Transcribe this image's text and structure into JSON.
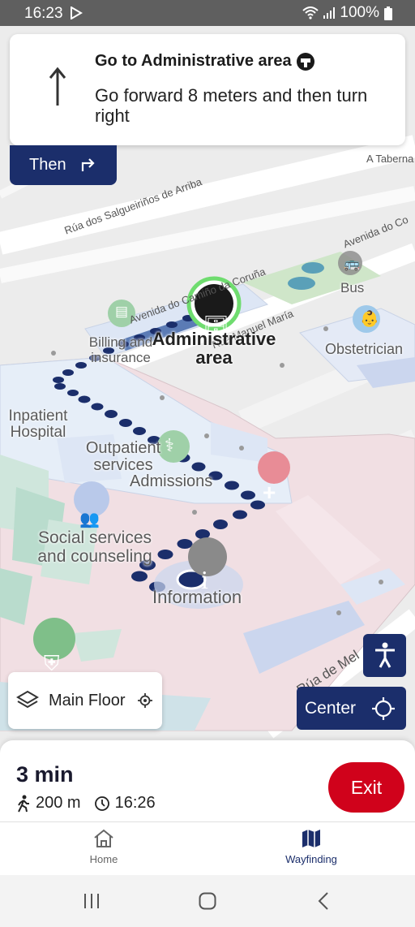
{
  "status": {
    "time": "16:23",
    "battery": "100%"
  },
  "instruction": {
    "destination": "Go to Administrative area",
    "step": "Go forward 8 meters and then turn right",
    "then_label": "Then"
  },
  "map": {
    "streets": [
      "Rúa dos Salgueiriños de Arriba",
      "Avenida do Co",
      "A Taberna c",
      "Avenida do Camiño da Coruña",
      "Rúa Manuel María",
      "Rúa de Mel"
    ],
    "pois": {
      "admin": "Administrative area",
      "billing": "Billing and insurance",
      "bus": "Bus",
      "obstetrician": "Obstetrician",
      "inpatient": "Inpatient Hospital",
      "outpatient": "Outpatient services",
      "admissions": "Admissions",
      "social": "Social services and counseling",
      "information": "Information"
    },
    "colors": {
      "route": "#1b2e6b",
      "accent": "#1b2e6b",
      "exit": "#d0021b"
    }
  },
  "controls": {
    "floor_label": "Main Floor",
    "center_label": "Center"
  },
  "trip": {
    "duration": "3 min",
    "distance": "200 m",
    "arrival": "16:26",
    "exit_label": "Exit"
  },
  "nav": {
    "home": "Home",
    "wayfinding": "Wayfinding"
  }
}
